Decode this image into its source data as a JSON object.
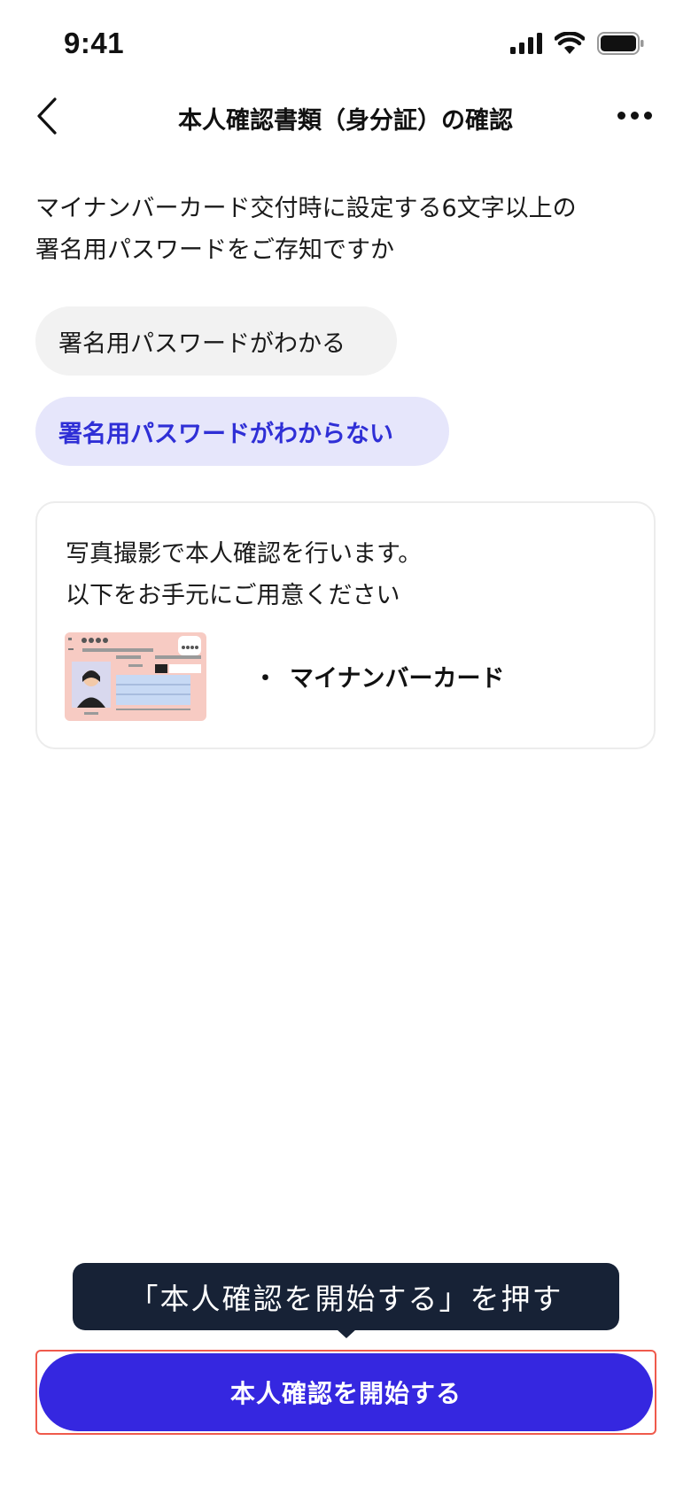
{
  "status_bar": {
    "time": "9:41",
    "icons": [
      "cellular-signal-icon",
      "wifi-icon",
      "battery-icon"
    ]
  },
  "nav": {
    "back_icon": "chevron-left-icon",
    "title": "本人確認書類（身分証）の確認",
    "more_icon": "more-dots-icon"
  },
  "question": {
    "line1": "マイナンバーカード交付時に設定する6文字以上の",
    "line2": "署名用パスワードをご存知ですか"
  },
  "choices": [
    {
      "label": "署名用パスワードがわかる",
      "selected": false
    },
    {
      "label": "署名用パスワードがわからない",
      "selected": true
    }
  ],
  "info_card": {
    "line1": "写真撮影で本人確認を行います。",
    "line2": "以下をお手元にご用意ください",
    "illustration_icon": "my-number-card-icon",
    "documents": [
      {
        "bullet": "・",
        "label": "マイナンバーカード"
      }
    ]
  },
  "tooltip": {
    "text": "「本人確認を開始する」を押す"
  },
  "cta": {
    "label": "本人確認を開始する"
  },
  "colors": {
    "accent": "#3527e0",
    "selected_text": "#2f2fd6",
    "selected_bg": "#e6e6fb",
    "unselected_bg": "#f2f2f2",
    "tooltip_bg": "#172236",
    "highlight_border": "#ef5a4c"
  }
}
